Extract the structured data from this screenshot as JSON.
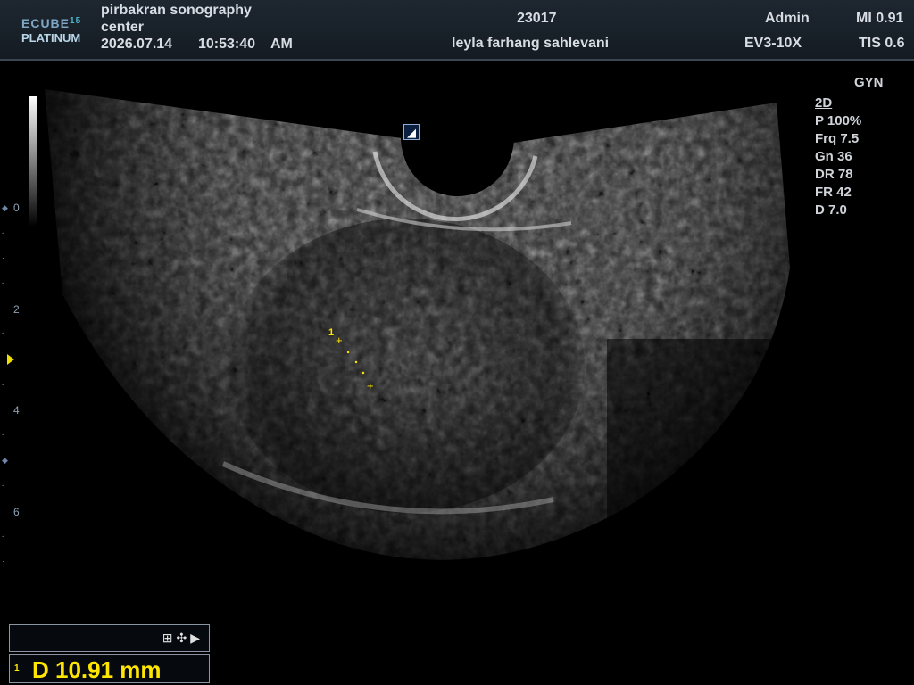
{
  "header": {
    "logo_line1": "ECUBE",
    "logo_num": "15",
    "logo_line2": "PLATINUM",
    "center_line1": "pirbakran sonography",
    "center_line2": "center",
    "date": "2026.07.14",
    "time": "10:53:40",
    "ampm": "AM",
    "patient_id": "23017",
    "patient_name": "leyla farhang sahlevani",
    "user": "Admin",
    "probe": "EV3-10X",
    "mi": "MI 0.91",
    "tis": "TIS 0.6"
  },
  "preset": "GYN",
  "params": {
    "mode": "2D",
    "power": "P 100%",
    "freq": "Frq 7.5",
    "gain": "Gn 36",
    "dr": "DR 78",
    "fr": "FR 42",
    "depth": "D 7.0"
  },
  "depth_scale": [
    "0",
    "2",
    "4",
    "6"
  ],
  "measurement": {
    "marker_label": "1",
    "index": "1",
    "value": "D  10.91 mm",
    "icons": "⊞✣▶"
  },
  "probe_marker_glyph": "◢"
}
